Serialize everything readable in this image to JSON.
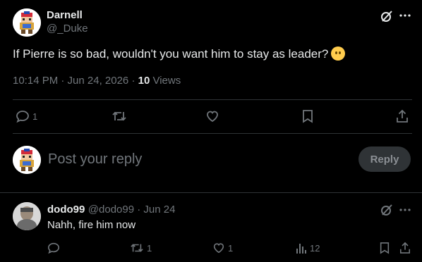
{
  "tweet": {
    "author_name": "Darnell",
    "author_handle": "@_Duke",
    "text": "If Pierre is so bad, wouldn't you want him to stay as leader?",
    "time": "10:14 PM · Jun 24, 2026 · ",
    "views_count": "10",
    "views_label": " Views",
    "actions": {
      "reply_count": "1",
      "retweet_count": "",
      "like_count": "",
      "bookmark_count": ""
    }
  },
  "composer": {
    "placeholder": "Post your reply",
    "button_label": "Reply"
  },
  "reply": {
    "author_name": "dodo99",
    "author_handle": "@dodo99",
    "date": " · Jun 24",
    "text": "Nahh, fire him now",
    "actions": {
      "reply_count": "",
      "retweet_count": "1",
      "like_count": "1",
      "views_count": "12"
    }
  },
  "colors": {
    "background": "#000000",
    "text": "#e7e9ea",
    "muted": "#71767b",
    "divider": "#2f3336",
    "button_bg": "#2f3336"
  },
  "icons": [
    "grok-icon",
    "more-icon",
    "reply-icon",
    "retweet-icon",
    "like-icon",
    "bookmark-icon",
    "share-icon",
    "views-icon",
    "thinking-face-emoji"
  ]
}
